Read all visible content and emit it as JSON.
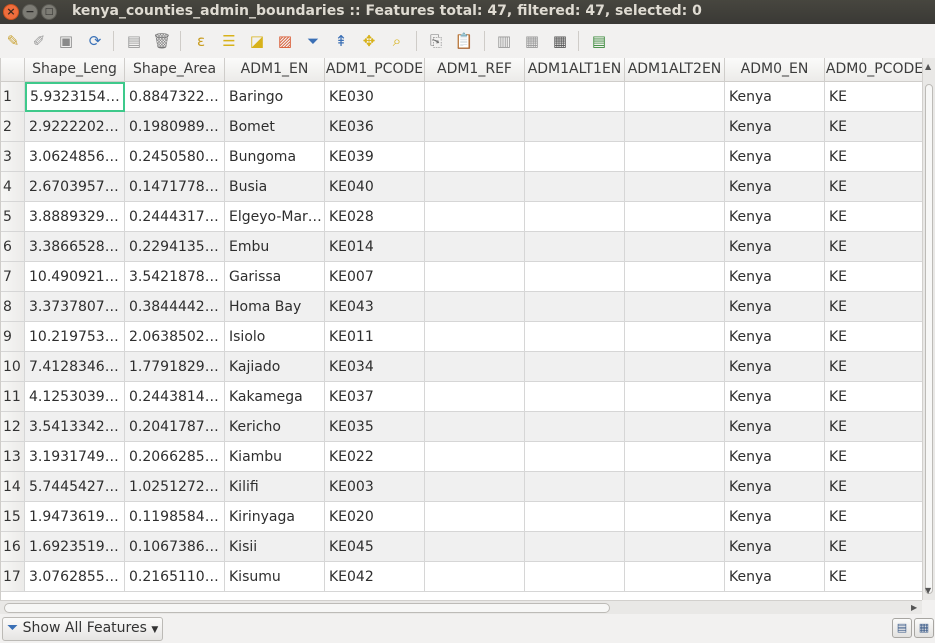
{
  "window": {
    "title": "kenya_counties_admin_boundaries :: Features total: 47, filtered: 47, selected: 0",
    "close_glyph": "×",
    "minimize_glyph": "−",
    "maximize_glyph": "□"
  },
  "toolbar": {
    "icons": [
      "pencil-icon",
      "save-edits-icon",
      "save-icon",
      "reload-icon",
      "add-feature-icon",
      "delete-feature-icon",
      "select-by-expression-icon",
      "select-all-icon",
      "invert-selection-icon",
      "deselect-all-icon",
      "filter-selection-icon",
      "move-selection-to-top-icon",
      "pan-to-selected-icon",
      "zoom-to-selected-icon",
      "copy-icon",
      "paste-icon",
      "new-field-icon",
      "delete-field-icon",
      "field-calculator-icon",
      "conditional-formatting-icon"
    ]
  },
  "table": {
    "columns": [
      "Shape_Leng",
      "Shape_Area",
      "ADM1_EN",
      "ADM1_PCODE",
      "ADM1_REF",
      "ADM1ALT1EN",
      "ADM1ALT2EN",
      "ADM0_EN",
      "ADM0_PCODE"
    ],
    "rows": [
      {
        "n": "1",
        "cells": [
          "5.9323154…",
          "0.8847322…",
          "Baringo",
          "KE030",
          "",
          "",
          "",
          "Kenya",
          "KE"
        ]
      },
      {
        "n": "2",
        "cells": [
          "2.9222202…",
          "0.1980989…",
          "Bomet",
          "KE036",
          "",
          "",
          "",
          "Kenya",
          "KE"
        ]
      },
      {
        "n": "3",
        "cells": [
          "3.0624856…",
          "0.2450580…",
          "Bungoma",
          "KE039",
          "",
          "",
          "",
          "Kenya",
          "KE"
        ]
      },
      {
        "n": "4",
        "cells": [
          "2.6703957…",
          "0.1471778…",
          "Busia",
          "KE040",
          "",
          "",
          "",
          "Kenya",
          "KE"
        ]
      },
      {
        "n": "5",
        "cells": [
          "3.8889329…",
          "0.2444317…",
          "Elgeyo-Mar…",
          "KE028",
          "",
          "",
          "",
          "Kenya",
          "KE"
        ]
      },
      {
        "n": "6",
        "cells": [
          "3.3866528…",
          "0.2294135…",
          "Embu",
          "KE014",
          "",
          "",
          "",
          "Kenya",
          "KE"
        ]
      },
      {
        "n": "7",
        "cells": [
          "10.490921…",
          "3.5421878…",
          "Garissa",
          "KE007",
          "",
          "",
          "",
          "Kenya",
          "KE"
        ]
      },
      {
        "n": "8",
        "cells": [
          "3.3737807…",
          "0.3844442…",
          "Homa Bay",
          "KE043",
          "",
          "",
          "",
          "Kenya",
          "KE"
        ]
      },
      {
        "n": "9",
        "cells": [
          "10.219753…",
          "2.0638502…",
          "Isiolo",
          "KE011",
          "",
          "",
          "",
          "Kenya",
          "KE"
        ]
      },
      {
        "n": "10",
        "cells": [
          "7.4128346…",
          "1.7791829…",
          "Kajiado",
          "KE034",
          "",
          "",
          "",
          "Kenya",
          "KE"
        ]
      },
      {
        "n": "11",
        "cells": [
          "4.1253039…",
          "0.2443814…",
          "Kakamega",
          "KE037",
          "",
          "",
          "",
          "Kenya",
          "KE"
        ]
      },
      {
        "n": "12",
        "cells": [
          "3.5413342…",
          "0.2041787…",
          "Kericho",
          "KE035",
          "",
          "",
          "",
          "Kenya",
          "KE"
        ]
      },
      {
        "n": "13",
        "cells": [
          "3.1931749…",
          "0.2066285…",
          "Kiambu",
          "KE022",
          "",
          "",
          "",
          "Kenya",
          "KE"
        ]
      },
      {
        "n": "14",
        "cells": [
          "5.7445427…",
          "1.0251272…",
          "Kilifi",
          "KE003",
          "",
          "",
          "",
          "Kenya",
          "KE"
        ]
      },
      {
        "n": "15",
        "cells": [
          "1.9473619…",
          "0.1198584…",
          "Kirinyaga",
          "KE020",
          "",
          "",
          "",
          "Kenya",
          "KE"
        ]
      },
      {
        "n": "16",
        "cells": [
          "1.6923519…",
          "0.1067386…",
          "Kisii",
          "KE045",
          "",
          "",
          "",
          "Kenya",
          "KE"
        ]
      },
      {
        "n": "17",
        "cells": [
          "3.0762855…",
          "0.2165110…",
          "Kisumu",
          "KE042",
          "",
          "",
          "",
          "Kenya",
          "KE"
        ]
      }
    ],
    "focused_cell": "row 1 Shape_Leng"
  },
  "status": {
    "filter_label": "Show All Features",
    "filter_icon": "filter-icon",
    "view_buttons": [
      "form-view-icon",
      "table-view-icon"
    ]
  },
  "colors": {
    "titlebar": "#3c3b37",
    "focus_border": "#3ec98b",
    "close_button": "#ef6d3d"
  }
}
